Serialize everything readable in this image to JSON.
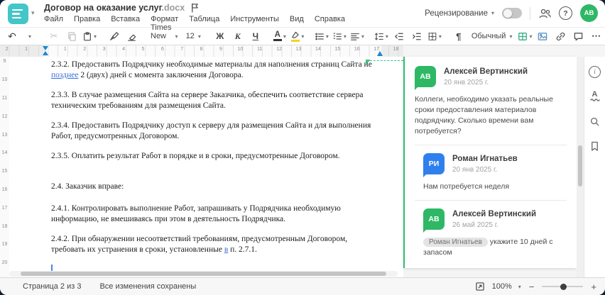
{
  "app": {
    "title": "Договор на оказание услуг",
    "title_ext": ".docx"
  },
  "menu": {
    "items": [
      "Файл",
      "Правка",
      "Вставка",
      "Формат",
      "Таблица",
      "Инструменты",
      "Вид",
      "Справка"
    ]
  },
  "header": {
    "review_label": "Рецензирование",
    "avatar_initials": "АВ"
  },
  "toolbar": {
    "font_name": "Times New ...",
    "font_size": "12",
    "bold": "Ж",
    "italic": "К",
    "underline": "Ч",
    "font_color_letter": "А",
    "pilcrow": "¶",
    "style_name": "Обычный"
  },
  "icons": {
    "undo": "↶",
    "caret": "▾",
    "scissors": "✂",
    "more": "⋯",
    "help": "?",
    "info": "i",
    "spell_letter": "А"
  },
  "ruler": {
    "h_numbers": [
      "2",
      "1",
      "",
      "1",
      "2",
      "3",
      "4",
      "5",
      "6",
      "7",
      "8",
      "9",
      "10",
      "11",
      "12",
      "13",
      "14",
      "15",
      "16",
      "17",
      "18"
    ],
    "v_numbers": [
      "9",
      "10",
      "11",
      "12",
      "13",
      "14",
      "15",
      "16",
      "17",
      "18",
      "19",
      "20"
    ]
  },
  "document": {
    "paragraphs": [
      {
        "pre": "2.3.2. Предоставить Подрядчику необходимые материалы для наполнения страниц Сайта не ",
        "ins": "позднее",
        "post": " 2 (двух) дней с момента заключения Договора."
      },
      {
        "text": "2.3.3. В случае размещения Сайта на сервере Заказчика, обеспечить соответствие сервера техническим требованиям для размещения Сайта."
      },
      {
        "text": "2.3.4. Предоставить Подрядчику доступ к серверу для размещения Сайта и для выполнения Работ, предусмотренных Договором."
      },
      {
        "text": "2.3.5. Оплатить результат Работ в порядке и в сроки, предусмотренные Договором."
      },
      {
        "text": "2.4. Заказчик вправе:"
      },
      {
        "text": "2.4.1. Контролировать выполнение Работ, запрашивать у Подрядчика необходимую информацию, не вмешиваясь при этом в деятельность Подрядчика."
      },
      {
        "pre": "2.4.2. При обнаружении несоответствий требованиям, предусмотренным Договором, требовать их устранения в сроки, установленные ",
        "ins": "в",
        "post": " п. 2.7.1."
      }
    ]
  },
  "comments": {
    "items": [
      {
        "initials": "АВ",
        "name": "Алексей Вертинский",
        "date": "20 янв 2025 г.",
        "text": "Коллеги, необходимо указать реальные сроки предоставления материалов подрядчику. Сколько времени вам потребуется?"
      },
      {
        "initials": "РИ",
        "name": "Роман Игнатьев",
        "date": "20 янв 2025 г.",
        "text": "Нам потребуется неделя"
      },
      {
        "initials": "АВ",
        "name": "Алексей Вертинский",
        "date": "26 май 2025 г.",
        "mention": "Роман Игнатьев",
        "text": "укажите 10 дней с запасом"
      }
    ]
  },
  "statusbar": {
    "page": "Страница 2 из 3",
    "saved": "Все изменения сохранены",
    "zoom": "100%",
    "zoom_out": "−",
    "zoom_in": "+"
  },
  "colors": {
    "accent_teal": "#43C6C8",
    "green_accent": "#2FBE6E",
    "blue_avatar": "#2F80ED",
    "insert_blue": "#3A6FD8",
    "marker_blue": "#1C86D1",
    "window_bg": "#0C1F33"
  }
}
